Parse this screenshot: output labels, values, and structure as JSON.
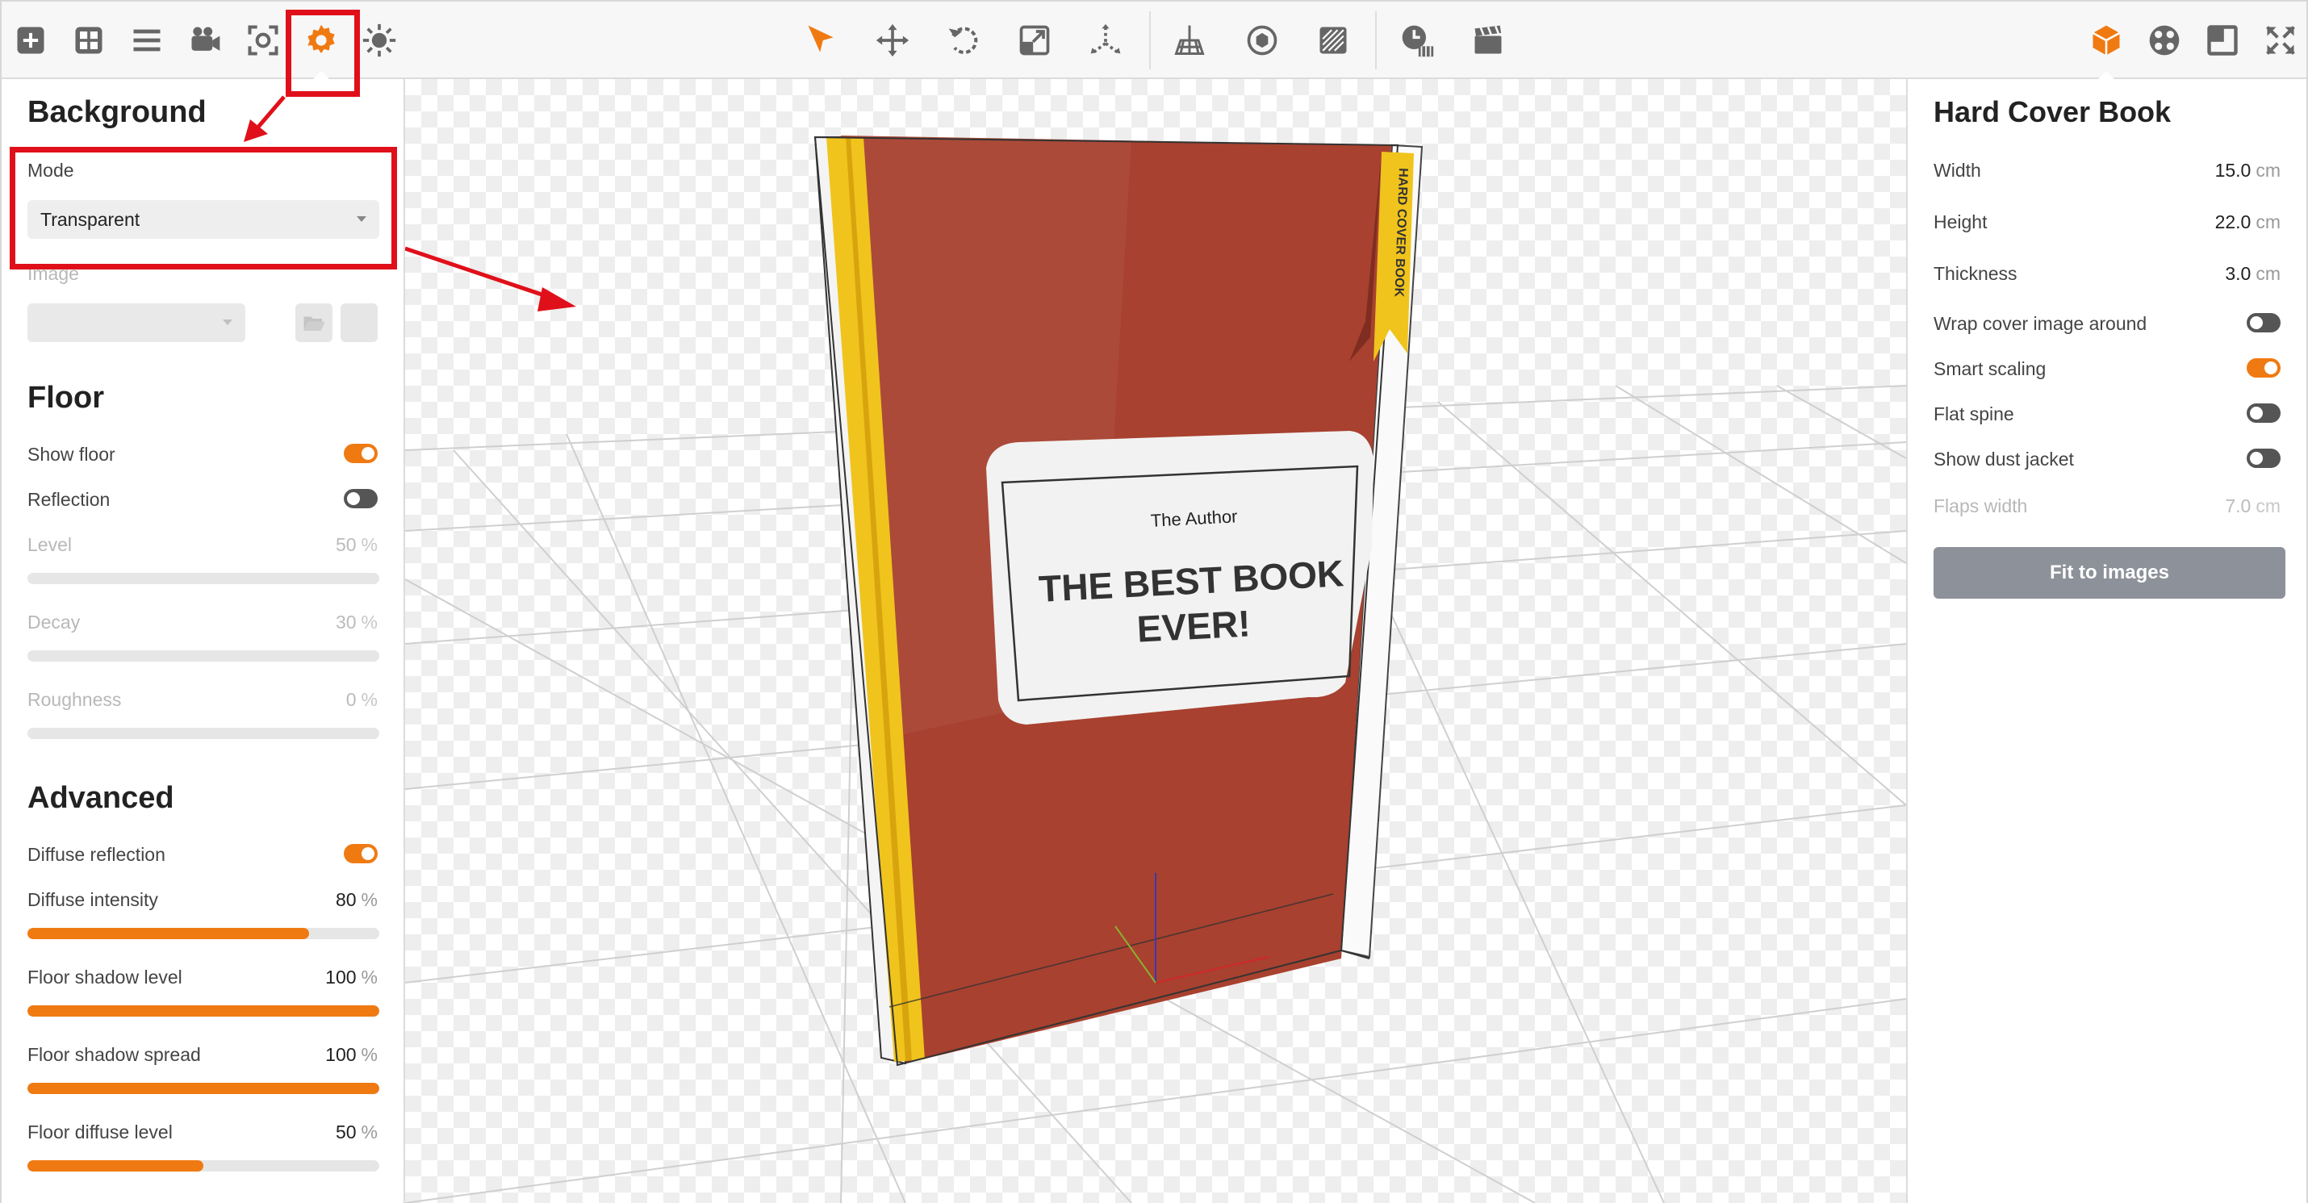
{
  "toolbar": {
    "left_tools": [
      "add-icon",
      "layout-icon",
      "menu-icon",
      "camera-icon",
      "focus-icon",
      "settings-icon",
      "light-icon"
    ],
    "center_tools": [
      "select-arrow-icon",
      "move-icon",
      "rotate-icon",
      "scale-icon",
      "axis-icon"
    ],
    "view_tools": [
      "floor-grid-icon",
      "sphere-icon",
      "texture-icon"
    ],
    "anim_tools": [
      "timer-icon",
      "clapperboard-icon"
    ],
    "right_tools": [
      "cube-icon",
      "material-ball-icon",
      "frame-icon",
      "fullscreen-icon"
    ],
    "accent_color": "#f07a12"
  },
  "left_panel": {
    "background": {
      "title": "Background",
      "mode_label": "Mode",
      "mode_value": "Transparent",
      "image_label": "Image",
      "image_value": ""
    },
    "floor": {
      "title": "Floor",
      "show_floor_label": "Show floor",
      "show_floor": true,
      "reflection_label": "Reflection",
      "reflection": false,
      "level_label": "Level",
      "level_value": "50",
      "level_unit": "%",
      "decay_label": "Decay",
      "decay_value": "30",
      "decay_unit": "%",
      "roughness_label": "Roughness",
      "roughness_value": "0",
      "roughness_unit": "%"
    },
    "advanced": {
      "title": "Advanced",
      "diffuse_reflection_label": "Diffuse reflection",
      "diffuse_reflection": true,
      "diffuse_intensity_label": "Diffuse intensity",
      "diffuse_intensity_value": "80",
      "diffuse_intensity_fraction": 0.8,
      "floor_shadow_level_label": "Floor shadow level",
      "floor_shadow_level_value": "100",
      "floor_shadow_level_fraction": 1.0,
      "floor_shadow_spread_label": "Floor shadow spread",
      "floor_shadow_spread_value": "100",
      "floor_shadow_spread_fraction": 1.0,
      "floor_diffuse_level_label": "Floor diffuse level",
      "floor_diffuse_level_value": "50",
      "floor_diffuse_level_fraction": 0.5,
      "unit": "%"
    }
  },
  "right_panel": {
    "title": "Hard Cover Book",
    "width_label": "Width",
    "width_value": "15.0",
    "height_label": "Height",
    "height_value": "22.0",
    "thickness_label": "Thickness",
    "thickness_value": "3.0",
    "unit": "cm",
    "wrap_label": "Wrap cover image around",
    "wrap": false,
    "smart_scaling_label": "Smart scaling",
    "smart_scaling": true,
    "flat_spine_label": "Flat spine",
    "flat_spine": false,
    "dust_jacket_label": "Show dust jacket",
    "dust_jacket": false,
    "flaps_width_label": "Flaps width",
    "flaps_width_value": "7.0",
    "fit_button": "Fit to images"
  },
  "viewport": {
    "book_author": "The Author",
    "book_title_line1": "THE BEST BOOK",
    "book_title_line2": "EVER!",
    "bookmark_text": "HARD COVER BOOK",
    "cover_color": "#a8412f",
    "spine_color": "#f0c41c"
  },
  "annotation_color": "#e0101a"
}
